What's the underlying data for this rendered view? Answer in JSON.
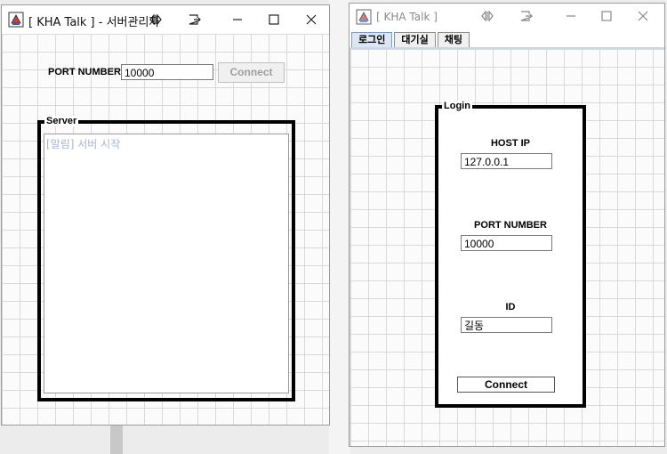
{
  "server_window": {
    "title": "[ KHA Talk ] - 서버관리자",
    "port_label": "PORT NUMBER",
    "port_value": "10000",
    "connect_label": "Connect",
    "panel_title": "Server",
    "log_lines": [
      "[알림] 서버 시작"
    ]
  },
  "client_window": {
    "title": "[ KHA Talk ]",
    "tabs": [
      "로그인",
      "대기실",
      "채팅"
    ],
    "active_tab": "로그인",
    "panel_title": "Login",
    "host_label": "HOST IP",
    "host_value": "127.0.0.1",
    "port_label": "PORT NUMBER",
    "port_value": "10000",
    "id_label": "ID",
    "id_value": "길동",
    "connect_label": "Connect"
  },
  "icons": {
    "app": "java-app-icon",
    "snap": "snap-layout-icon",
    "move": "move-window-icon",
    "minimize": "minimize-icon",
    "maximize": "maximize-icon",
    "close": "close-icon"
  },
  "colors": {
    "grid_line": "#d9d9d9",
    "log_text": "#a4b6d2",
    "active_tab": "#dce6f4",
    "panel_border": "#000000"
  }
}
